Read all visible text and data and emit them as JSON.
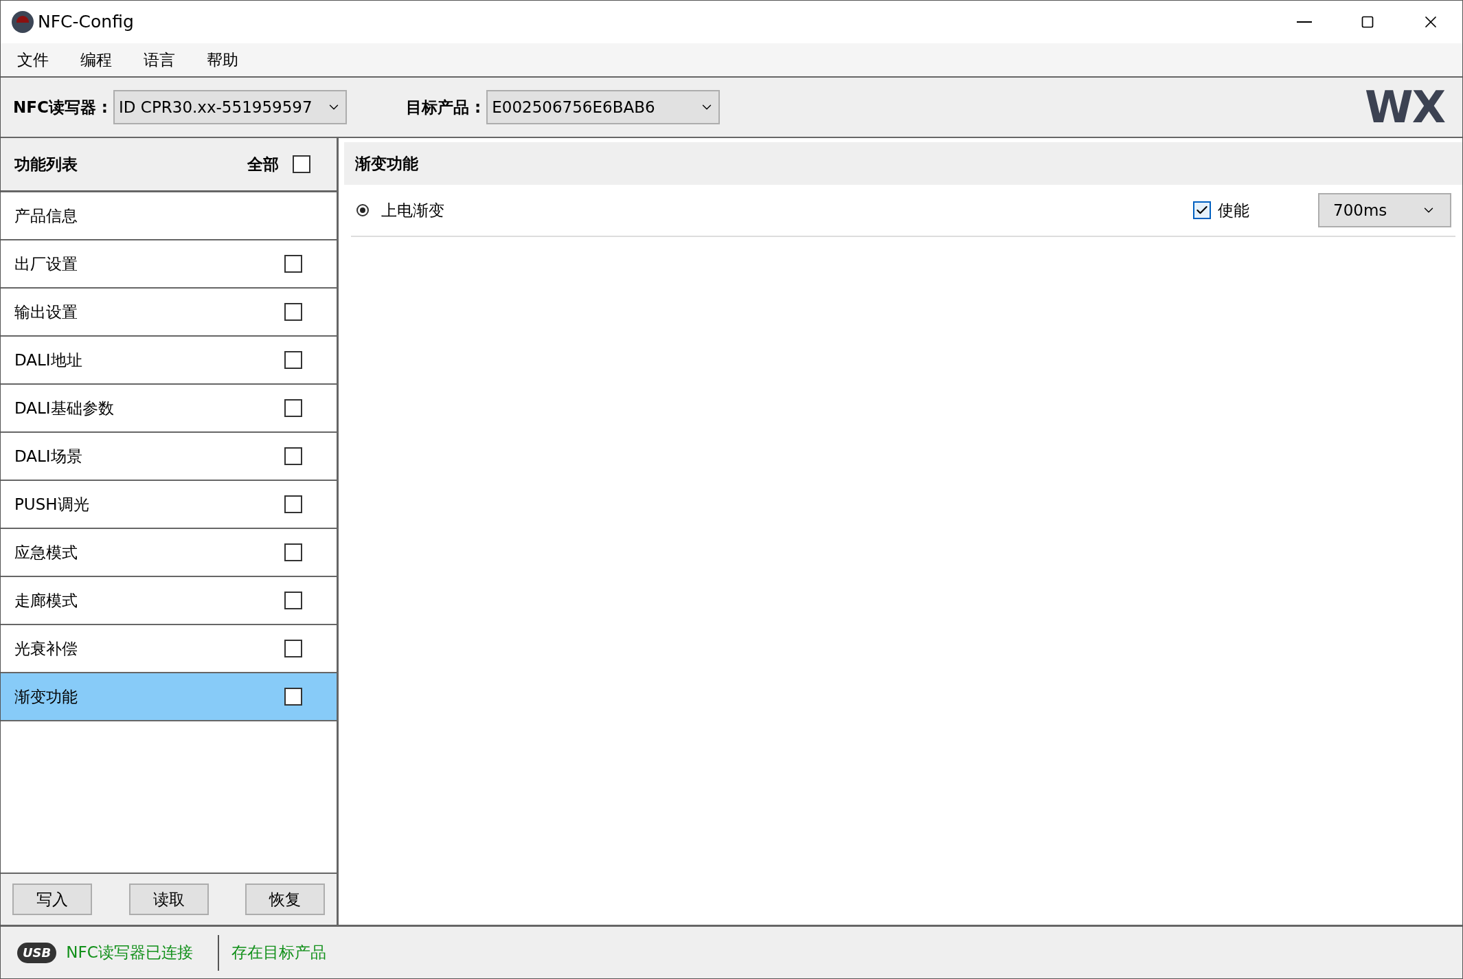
{
  "window": {
    "title": "NFC-Config"
  },
  "menu": [
    "文件",
    "编程",
    "语言",
    "帮助"
  ],
  "toolbar": {
    "reader_label": "NFC读写器 :",
    "reader_value": "ID CPR30.xx-551959597",
    "product_label": "目标产品 :",
    "product_value": "E002506756E6BAB6",
    "logo": "WX"
  },
  "function_list": {
    "title": "功能列表",
    "all_label": "全部",
    "all_checked": false,
    "items": [
      {
        "label": "产品信息",
        "has_checkbox": false,
        "selected": false
      },
      {
        "label": "出厂设置",
        "has_checkbox": true,
        "checked": false,
        "selected": false
      },
      {
        "label": "输出设置",
        "has_checkbox": true,
        "checked": false,
        "selected": false
      },
      {
        "label": "DALI地址",
        "has_checkbox": true,
        "checked": false,
        "selected": false
      },
      {
        "label": "DALI基础参数",
        "has_checkbox": true,
        "checked": false,
        "selected": false
      },
      {
        "label": "DALI场景",
        "has_checkbox": true,
        "checked": false,
        "selected": false
      },
      {
        "label": "PUSH调光",
        "has_checkbox": true,
        "checked": false,
        "selected": false
      },
      {
        "label": "应急模式",
        "has_checkbox": true,
        "checked": false,
        "selected": false
      },
      {
        "label": "走廊模式",
        "has_checkbox": true,
        "checked": false,
        "selected": false
      },
      {
        "label": "光衰补偿",
        "has_checkbox": true,
        "checked": false,
        "selected": false
      },
      {
        "label": "渐变功能",
        "has_checkbox": true,
        "checked": false,
        "selected": true
      }
    ],
    "buttons": [
      "写入",
      "读取",
      "恢复"
    ]
  },
  "panel": {
    "title": "渐变功能",
    "rows": [
      {
        "label": "上电渐变",
        "selected": true,
        "enable_label": "使能",
        "enabled": true,
        "value": "700ms"
      }
    ]
  },
  "status_bar": {
    "usb_badge": "USB",
    "items": [
      "NFC读写器已连接",
      "存在目标产品"
    ]
  }
}
